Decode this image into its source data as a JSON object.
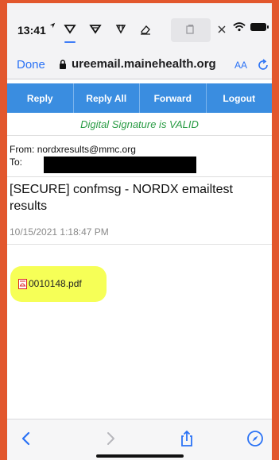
{
  "status_bar": {
    "time": "13:41"
  },
  "address_bar": {
    "done_label": "Done",
    "url": "ureemail.mainehealth.org",
    "text_size_label": "AA"
  },
  "actions": [
    {
      "label": "Reply"
    },
    {
      "label": "Reply All"
    },
    {
      "label": "Forward"
    },
    {
      "label": "Logout"
    }
  ],
  "signature_status": "Digital Signature is VALID",
  "message": {
    "from_label": "From:",
    "from_address": "nordxresults@mmc.org",
    "to_label": "To:",
    "subject": "[SECURE] confmsg - NORDX emailtest results",
    "date": "10/15/2021 1:18:47 PM",
    "attachment": "0010148.pdf"
  },
  "colors": {
    "accent": "#2a72f5",
    "action_bar": "#3a8de0",
    "signature_valid": "#2a9c45",
    "attachment_highlight": "#f6ff57",
    "frame": "#e2572d"
  },
  "icons": {
    "toolbar": [
      "filter-icon",
      "filter-outline-icon",
      "filter-strike-icon",
      "eraser-icon",
      "copy-icon",
      "close-icon"
    ],
    "bottom": [
      "back-icon",
      "forward-icon",
      "share-icon",
      "compass-icon"
    ]
  }
}
